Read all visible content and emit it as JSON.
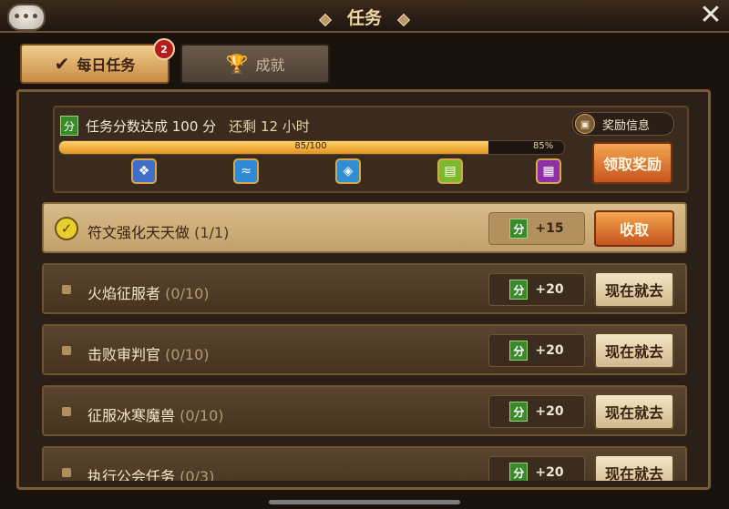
{
  "header": {
    "title": "任务",
    "chat_icon": "chat-bubble-icon",
    "close_icon": "close-icon"
  },
  "tabs": [
    {
      "label": "每日任务",
      "icon": "check-icon",
      "badge": "2",
      "active": true
    },
    {
      "label": "成就",
      "icon": "trophy-icon",
      "active": false
    }
  ],
  "score": {
    "icon_text": "分",
    "title": "任务分数达成 100 分",
    "remaining": "还剩 12 小时",
    "reward_info_label": "奖励信息",
    "progress_text": "85/100",
    "progress_percent_text": "85%",
    "progress_fraction": 0.85,
    "claim_label": "领取奖励",
    "milestones": [
      {
        "icon": "rune-scroll-icon",
        "color": "#3f6fc9"
      },
      {
        "icon": "water-scroll-icon",
        "color": "#2e89d6"
      },
      {
        "icon": "mystic-pouch-icon",
        "color": "#2f8fd1"
      },
      {
        "icon": "summon-scroll-icon",
        "color": "#7fb82a"
      },
      {
        "icon": "treasure-chest-icon",
        "color": "#8e2fa8"
      }
    ]
  },
  "quests": [
    {
      "name": "符文强化天天做",
      "progress": "(1/1)",
      "points": "+15",
      "action": "收取",
      "done": true
    },
    {
      "name": "火焰征服者",
      "progress": "(0/10)",
      "points": "+20",
      "action": "现在就去",
      "done": false
    },
    {
      "name": "击败审判官",
      "progress": "(0/10)",
      "points": "+20",
      "action": "现在就去",
      "done": false
    },
    {
      "name": "征服冰寒魔兽",
      "progress": "(0/10)",
      "points": "+20",
      "action": "现在就去",
      "done": false
    },
    {
      "name": "执行公会任务",
      "progress": "(0/3)",
      "points": "+20",
      "action": "现在就去",
      "done": false
    }
  ],
  "points_icon_text": "分"
}
